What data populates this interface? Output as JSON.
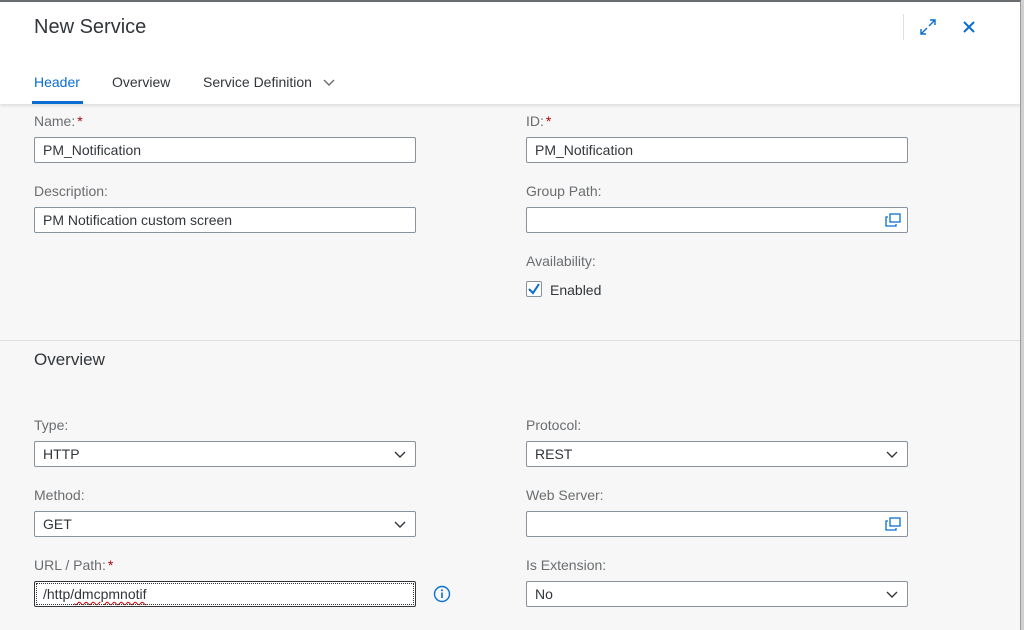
{
  "dialog": {
    "title": "New Service",
    "icons": {
      "expand": "expand-icon",
      "close": "close-icon"
    }
  },
  "tabs": [
    {
      "label": "Header",
      "active": true
    },
    {
      "label": "Overview",
      "active": false
    },
    {
      "label": "Service Definition",
      "active": false,
      "has_menu": true
    }
  ],
  "header_section": {
    "name": {
      "label": "Name:",
      "required": "*",
      "value": "PM_Notification"
    },
    "id": {
      "label": "ID:",
      "required": "*",
      "value": "PM_Notification"
    },
    "description": {
      "label": "Description:",
      "value": "PM Notification custom screen"
    },
    "group_path": {
      "label": "Group Path:",
      "value": "",
      "icon": "value-help-icon"
    },
    "availability": {
      "label": "Availability:",
      "checkbox_label": "Enabled",
      "checked": true
    }
  },
  "overview_section": {
    "title": "Overview",
    "type": {
      "label": "Type:",
      "value": "HTTP"
    },
    "protocol": {
      "label": "Protocol:",
      "value": "REST"
    },
    "method": {
      "label": "Method:",
      "value": "GET"
    },
    "web_server": {
      "label": "Web Server:",
      "value": "",
      "icon": "value-help-icon"
    },
    "url_path": {
      "label": "URL / Path:",
      "required": "*",
      "value_prefix": "/http/",
      "value_misspelled": "dmcpmnotif"
    },
    "is_extension": {
      "label": "Is Extension:",
      "value": "No"
    }
  },
  "colors": {
    "accent": "#0a6ed1",
    "required": "#bb0000",
    "text": "#32363a",
    "label": "#6a6d70"
  }
}
